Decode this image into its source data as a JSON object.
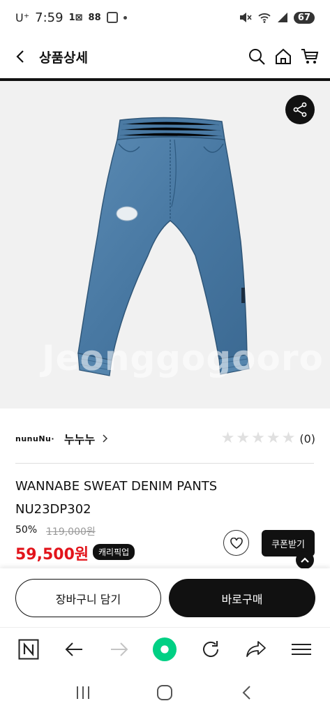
{
  "status_bar": {
    "carrier": "U⁺",
    "time": "7:59",
    "battery": "67",
    "icons": [
      "1x-icon",
      "grid-88-icon",
      "sim-box-icon",
      "dot-icon",
      "mute-icon",
      "wifi-icon",
      "signal-icon",
      "battery-icon"
    ]
  },
  "header": {
    "title": "상품상세",
    "icons": [
      "back-arrow-icon",
      "search-icon",
      "home-icon",
      "cart-icon"
    ]
  },
  "product_image": {
    "watermark": "Jeonggogooro",
    "share_icon": "share-icon"
  },
  "brand": {
    "logo": "nunuNu·",
    "name": "누누누",
    "rating_count": "(0)",
    "stars": 5,
    "rating": 0
  },
  "product": {
    "name": "WANNABE SWEAT DENIM PANTS",
    "code": "NU23DP302",
    "discount": "50%",
    "original_price": "119,000원",
    "price": "59,500원",
    "pickup_badge": "캐리픽업",
    "coupon_label": "쿠폰받기"
  },
  "buy_bar": {
    "cart_label": "장바구니 담기",
    "buy_label": "바로구매"
  },
  "browser_bar": {
    "icons": [
      "naver-n-icon",
      "back-icon",
      "forward-icon",
      "green-dot-icon",
      "refresh-icon",
      "share-arrow-icon",
      "menu-icon"
    ]
  },
  "colors": {
    "price_red": "#e2141b",
    "black": "#111111",
    "green": "#00d084",
    "denim": "#4d7ea6"
  }
}
